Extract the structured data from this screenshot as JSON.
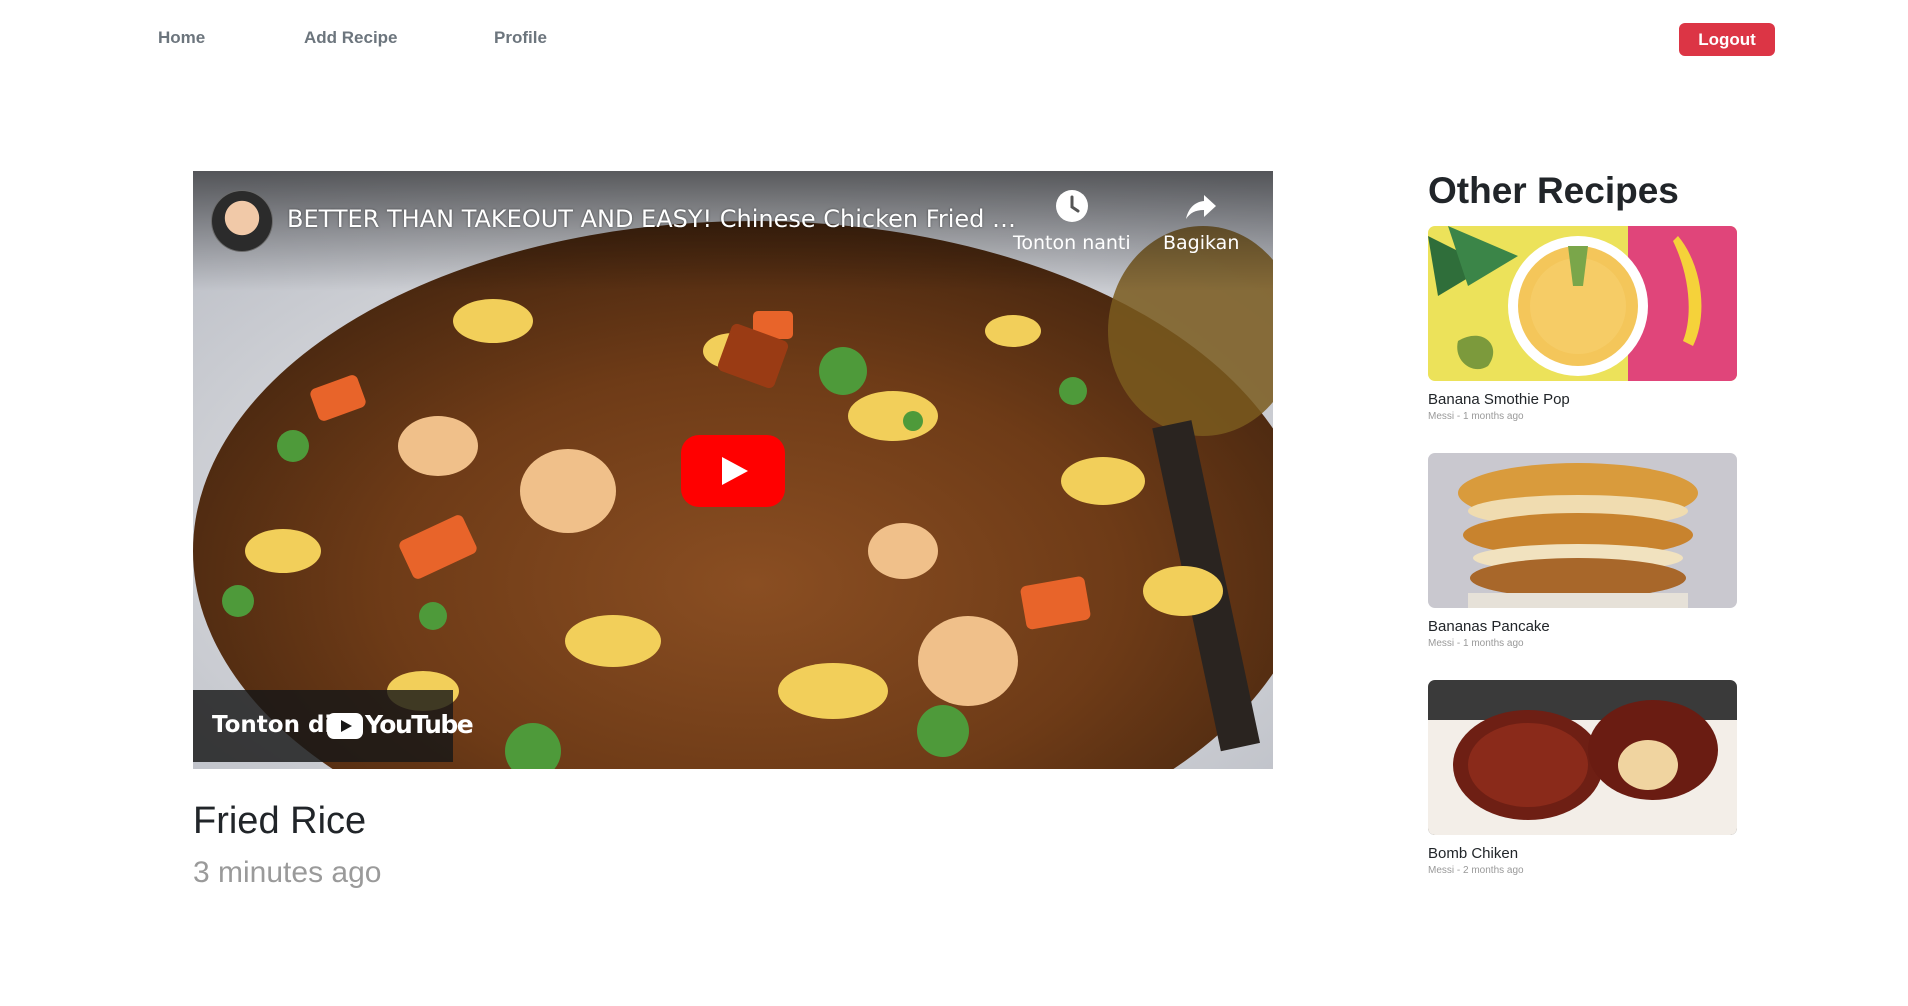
{
  "nav": {
    "home": "Home",
    "add_recipe": "Add Recipe",
    "profile": "Profile",
    "logout": "Logout"
  },
  "video": {
    "title": "BETTER THAN TAKEOUT AND EASY! Chinese Chicken Fried Rice Recipe",
    "watch_later_label": "Tonton nanti",
    "share_label": "Bagikan",
    "watch_on_label": "Tonton di",
    "youtube_word": "YouTube"
  },
  "recipe": {
    "title": "Fried Rice",
    "time": "3 minutes ago"
  },
  "sidebar": {
    "heading": "Other Recipes",
    "items": [
      {
        "name": "Banana Smothie Pop",
        "meta": "Messi - 1 months ago"
      },
      {
        "name": "Bananas Pancake",
        "meta": "Messi - 1 months ago"
      },
      {
        "name": "Bomb Chiken",
        "meta": "Messi - 2 months ago"
      }
    ]
  },
  "colors": {
    "logout_bg": "#dc3545",
    "nav_text": "#6c757d",
    "youtube_red": "#ff0000"
  }
}
